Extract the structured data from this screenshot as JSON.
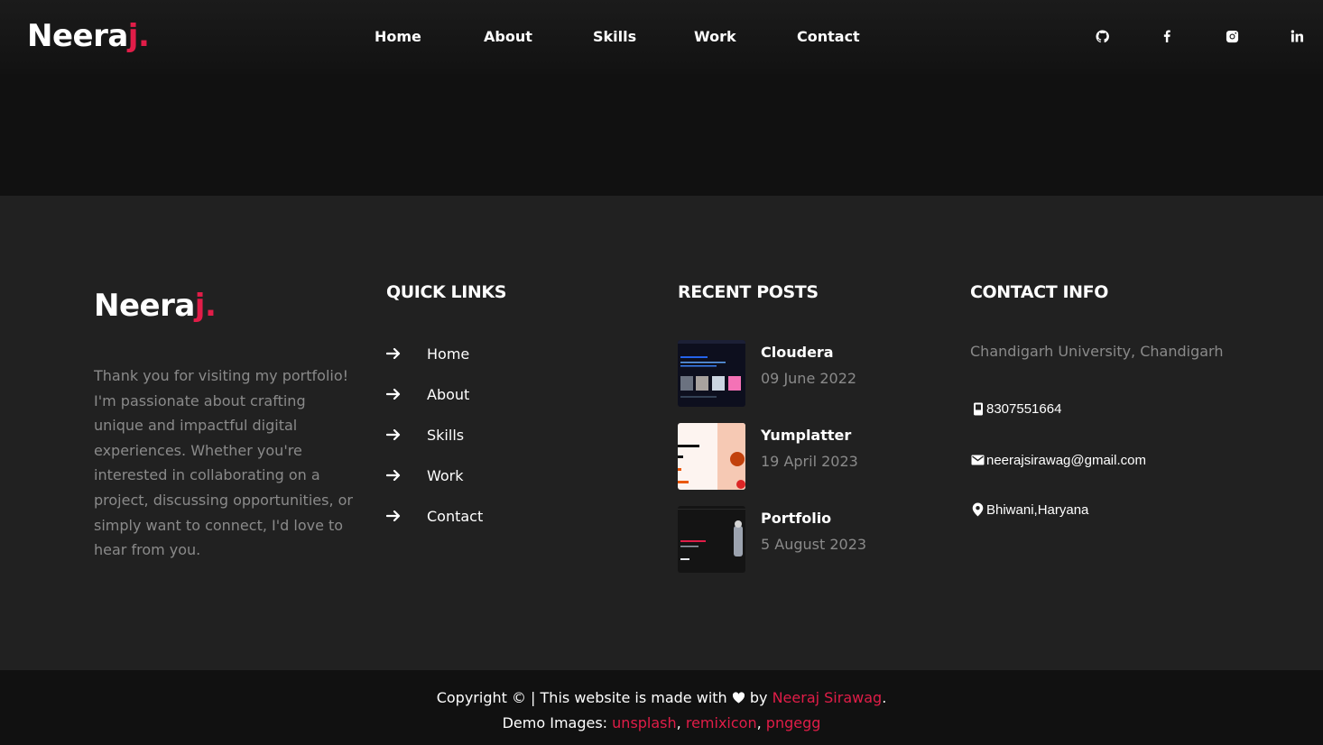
{
  "brand": {
    "name": "Neera",
    "accent_letter": "j",
    "dot": "."
  },
  "nav": {
    "links": [
      "Home",
      "About",
      "Skills",
      "Work",
      "Contact"
    ],
    "social": [
      "github-icon",
      "facebook-icon",
      "instagram-icon",
      "linkedin-icon"
    ]
  },
  "footer": {
    "about_text": "Thank you for visiting my portfolio! I'm passionate about crafting unique and impactful digital experiences. Whether you're interested in collaborating on a project, discussing opportunities, or simply want to connect, I'd love to hear from you.",
    "quick_links": {
      "title": "QUICK LINKS",
      "items": [
        "Home",
        "About",
        "Skills",
        "Work",
        "Contact"
      ]
    },
    "recent_posts": {
      "title": "RECENT POSTS",
      "items": [
        {
          "title": "Cloudera",
          "date": "09 June 2022"
        },
        {
          "title": "Yumplatter",
          "date": "19 April 2023"
        },
        {
          "title": "Portfolio",
          "date": "5 August 2023"
        }
      ]
    },
    "contact": {
      "title": "CONTACT INFO",
      "address": "Chandigarh University, Chandigarh",
      "phone": "8307551664",
      "email": "neerajsirawag@gmail.com",
      "location": "Bhiwani,Haryana"
    }
  },
  "bottom": {
    "copyright_prefix": "Copyright © | This website is made with",
    "by": "by",
    "author": "Neeraj Sirawag",
    "period": ".",
    "demo_prefix": "Demo Images:",
    "sources": [
      "unsplash",
      "remixicon",
      "pngegg"
    ],
    "comma": ","
  },
  "colors": {
    "accent": "#e11d48",
    "footer_bg": "#212121",
    "page_bg": "#111111",
    "muted_text": "#8a8a8a"
  }
}
